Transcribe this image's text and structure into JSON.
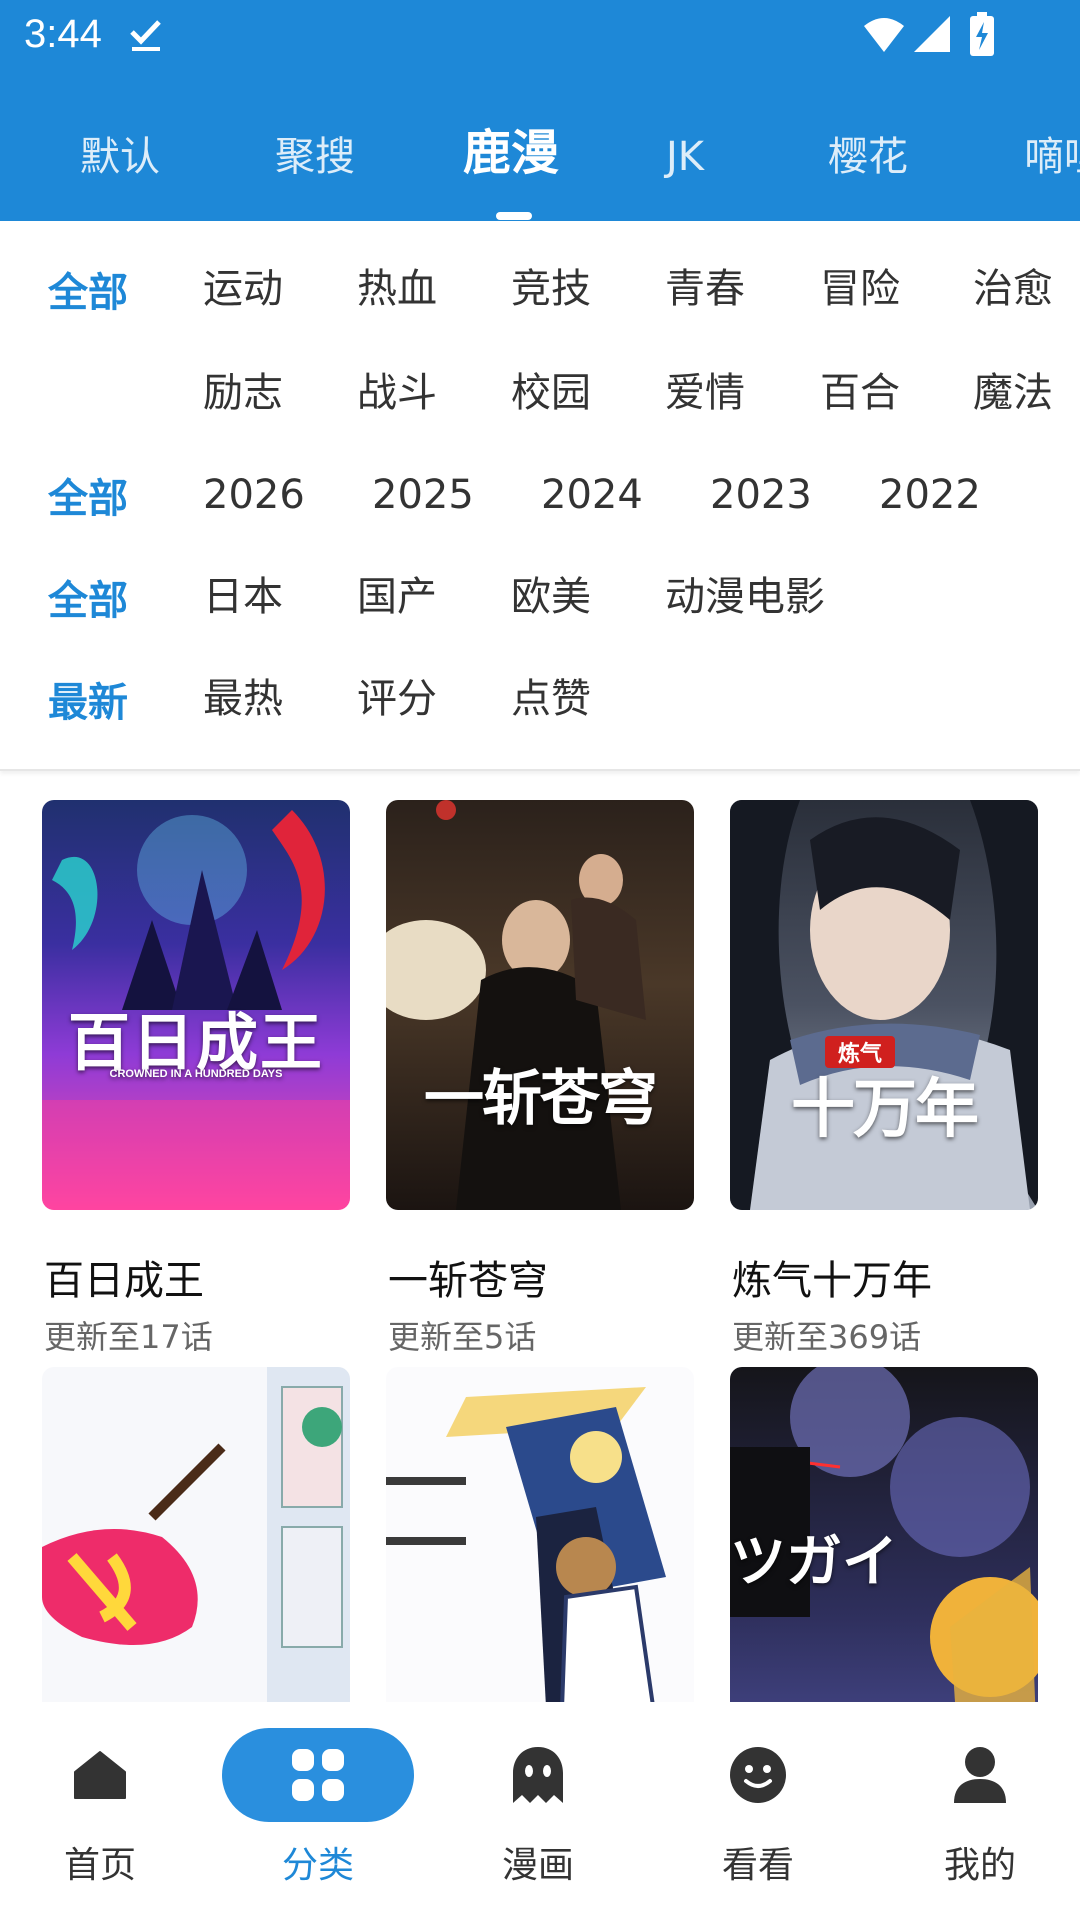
{
  "status": {
    "time": "3:44"
  },
  "source_tabs": [
    "默认",
    "聚搜",
    "鹿漫",
    "JK",
    "樱花",
    "嘀哩"
  ],
  "active_source": "鹿漫",
  "filters": {
    "genre": {
      "selected": "全部",
      "row1": [
        "运动",
        "热血",
        "竞技",
        "青春",
        "冒险",
        "治愈"
      ],
      "row2": [
        "励志",
        "战斗",
        "校园",
        "爱情",
        "百合",
        "魔法"
      ]
    },
    "year": {
      "selected": "全部",
      "items": [
        "2026",
        "2025",
        "2024",
        "2023",
        "2022"
      ]
    },
    "region": {
      "selected": "全部",
      "items": [
        "日本",
        "国产",
        "欧美",
        "动漫电影"
      ]
    },
    "sort": {
      "selected": "最新",
      "items": [
        "最热",
        "评分",
        "点赞"
      ]
    }
  },
  "cards": [
    {
      "title": "百日成王",
      "subtitle": "更新至17话",
      "cover_text": "百日成王",
      "cover_sub": "CROWNED IN A HUNDRED DAYS",
      "colors": [
        "#1b2a6b",
        "#8a3fd0",
        "#ff4fa0"
      ]
    },
    {
      "title": "一斩苍穹",
      "subtitle": "更新至5话",
      "cover_text": "一斩苍穹",
      "colors": [
        "#3a2c22",
        "#1a1512",
        "#5b4634"
      ]
    },
    {
      "title": "炼气十万年",
      "subtitle": "更新至369话",
      "cover_text": "十万年",
      "cover_badge": "炼气",
      "colors": [
        "#3b4250",
        "#1f2430",
        "#8f98a8"
      ]
    },
    {
      "title": "",
      "subtitle": "",
      "colors": [
        "#ffffff",
        "#dce4ef",
        "#f0b7c6"
      ]
    },
    {
      "title": "",
      "subtitle": "",
      "colors": [
        "#ffffff",
        "#e9eef6",
        "#8aa4d8"
      ]
    },
    {
      "title": "",
      "subtitle": "",
      "cover_text": "ツガイ",
      "colors": [
        "#101014",
        "#3d3f7a",
        "#6a6db8"
      ]
    }
  ],
  "bottom_nav": [
    {
      "label": "首页",
      "icon": "home-icon"
    },
    {
      "label": "分类",
      "icon": "category-grid-icon"
    },
    {
      "label": "漫画",
      "icon": "ghost-icon"
    },
    {
      "label": "看看",
      "icon": "smile-icon"
    },
    {
      "label": "我的",
      "icon": "person-icon"
    }
  ],
  "active_nav": "分类",
  "colors": {
    "primary": "#1e88d7",
    "nav_active": "#2a8fde"
  }
}
